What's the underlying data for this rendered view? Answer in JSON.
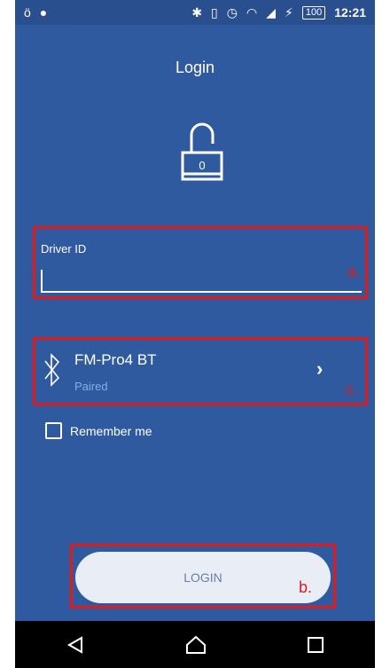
{
  "status": {
    "time": "12:21",
    "battery": "100"
  },
  "screen": {
    "title": "Login"
  },
  "driver": {
    "label": "Driver ID",
    "value": "",
    "annotation": "a."
  },
  "device": {
    "name": "FM-Pro4 BT",
    "status": "Paired",
    "annotation": "c."
  },
  "remember": {
    "label": "Remember me",
    "checked": false
  },
  "login": {
    "label": "LOGIN",
    "annotation": "b."
  },
  "colors": {
    "background": "#2f5aa0",
    "highlight": "#e21a1a",
    "paired": "#7fb0e8"
  }
}
